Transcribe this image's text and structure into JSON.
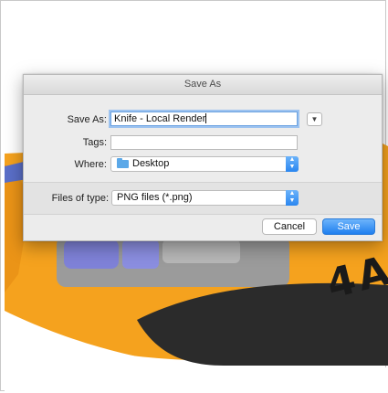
{
  "dialog": {
    "title": "Save As",
    "save_as_label": "Save As:",
    "save_as_value": "Knife - Local Render",
    "tags_label": "Tags:",
    "tags_value": "",
    "where_label": "Where:",
    "where_value": "Desktop",
    "files_of_type_label": "Files of type:",
    "files_of_type_value": "PNG files (*.png)",
    "cancel_label": "Cancel",
    "save_label": "Save"
  },
  "background_render": {
    "text": "4A"
  },
  "colors": {
    "accent": "#2a86f0",
    "knife_orange": "#f5a21e",
    "knife_grip": "#2b2b2b",
    "knife_blue": "#5a6fc8"
  }
}
